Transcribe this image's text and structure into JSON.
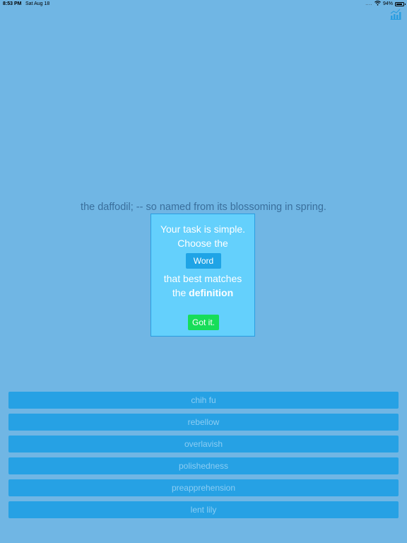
{
  "status_bar": {
    "time": "8:53 PM",
    "date": "Sat Aug 18",
    "signal": "....",
    "battery": "94%",
    "battery_level": 0.94,
    "wifi_icon": "wifi-icon",
    "battery_icon": "battery-icon"
  },
  "toolbar": {
    "stats_icon": "bar-chart-icon",
    "accent": "#2a9de0"
  },
  "definition": "the daffodil; -- so named from its blossoming in spring.",
  "instructions": {
    "line1": "Your task is simple.",
    "line2": "Choose the",
    "word_chip": "Word",
    "line3": "that best matches",
    "line4_prefix": "the ",
    "line4_emph": "definition",
    "dismiss_button": "Got it."
  },
  "choices": [
    {
      "label": "chih fu"
    },
    {
      "label": "rebellow"
    },
    {
      "label": "overlavish"
    },
    {
      "label": "polishedness"
    },
    {
      "label": "preapprehension"
    },
    {
      "label": "lent lily"
    }
  ],
  "colors": {
    "background": "#70b6e4",
    "modal": "#64d0fc",
    "choice_button": "#26a1e4",
    "got_it_button": "#17dd59"
  }
}
